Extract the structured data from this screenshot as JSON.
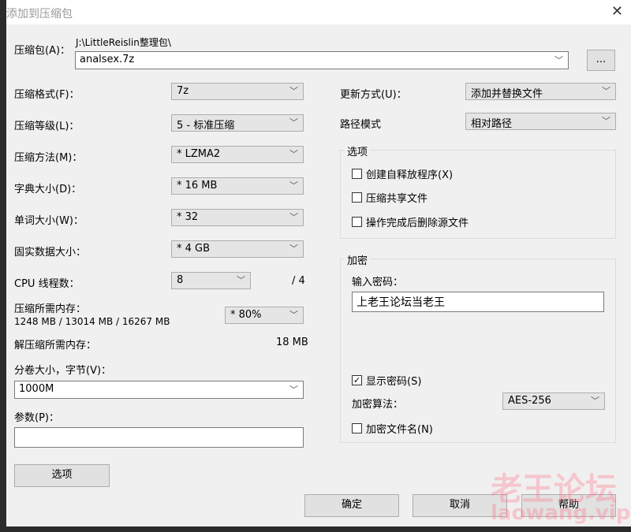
{
  "window": {
    "title": "添加到压缩包",
    "close": "✕"
  },
  "archive": {
    "label": "压缩包(A)：",
    "path": "J:\\LittleReislin整理包\\",
    "name": "analsex.7z",
    "browse": "..."
  },
  "left": {
    "format": {
      "label": "压缩格式(F)：",
      "value": "7z"
    },
    "level": {
      "label": "压缩等级(L)：",
      "value": "5 - 标准压缩"
    },
    "method": {
      "label": "压缩方法(M)：",
      "value": "* LZMA2"
    },
    "dict": {
      "label": "字典大小(D)：",
      "value": "* 16 MB"
    },
    "word": {
      "label": "单词大小(W)：",
      "value": "* 32"
    },
    "solid": {
      "label": "固实数据大小：",
      "value": "* 4 GB"
    },
    "cpu": {
      "label": "CPU 线程数：",
      "value": "8",
      "max": "/ 4"
    },
    "mem": {
      "label": "压缩所需内存：",
      "detail": "1248 MB / 13014 MB / 16267 MB",
      "value": "* 80%"
    },
    "dmem": {
      "label": "解压缩所需内存：",
      "value": "18 MB"
    },
    "volume": {
      "label": "分卷大小，字节(V)：",
      "value": "1000M"
    },
    "params": {
      "label": "参数(P)：",
      "value": ""
    },
    "options_button": "选项"
  },
  "right": {
    "update": {
      "label": "更新方式(U)：",
      "value": "添加并替换文件"
    },
    "pathmode": {
      "label": "路径模式",
      "value": "相对路径"
    },
    "options": {
      "title": "选项",
      "items": [
        {
          "label": "创建自释放程序(X)",
          "checked": false
        },
        {
          "label": "压缩共享文件",
          "checked": false
        },
        {
          "label": "操作完成后删除源文件",
          "checked": false
        }
      ]
    },
    "encryption": {
      "title": "加密",
      "pw_label": "输入密码：",
      "password": "上老王论坛当老王",
      "show_pw": {
        "label": "显示密码(S)",
        "checked": true
      },
      "algo_label": "加密算法：",
      "algo": "AES-256",
      "encrypt_names": {
        "label": "加密文件名(N)",
        "checked": false
      }
    }
  },
  "buttons": {
    "ok": "确定",
    "cancel": "取消",
    "help": "帮助"
  },
  "watermark": {
    "line1": "老王论坛",
    "line2": "laowang.vip"
  }
}
